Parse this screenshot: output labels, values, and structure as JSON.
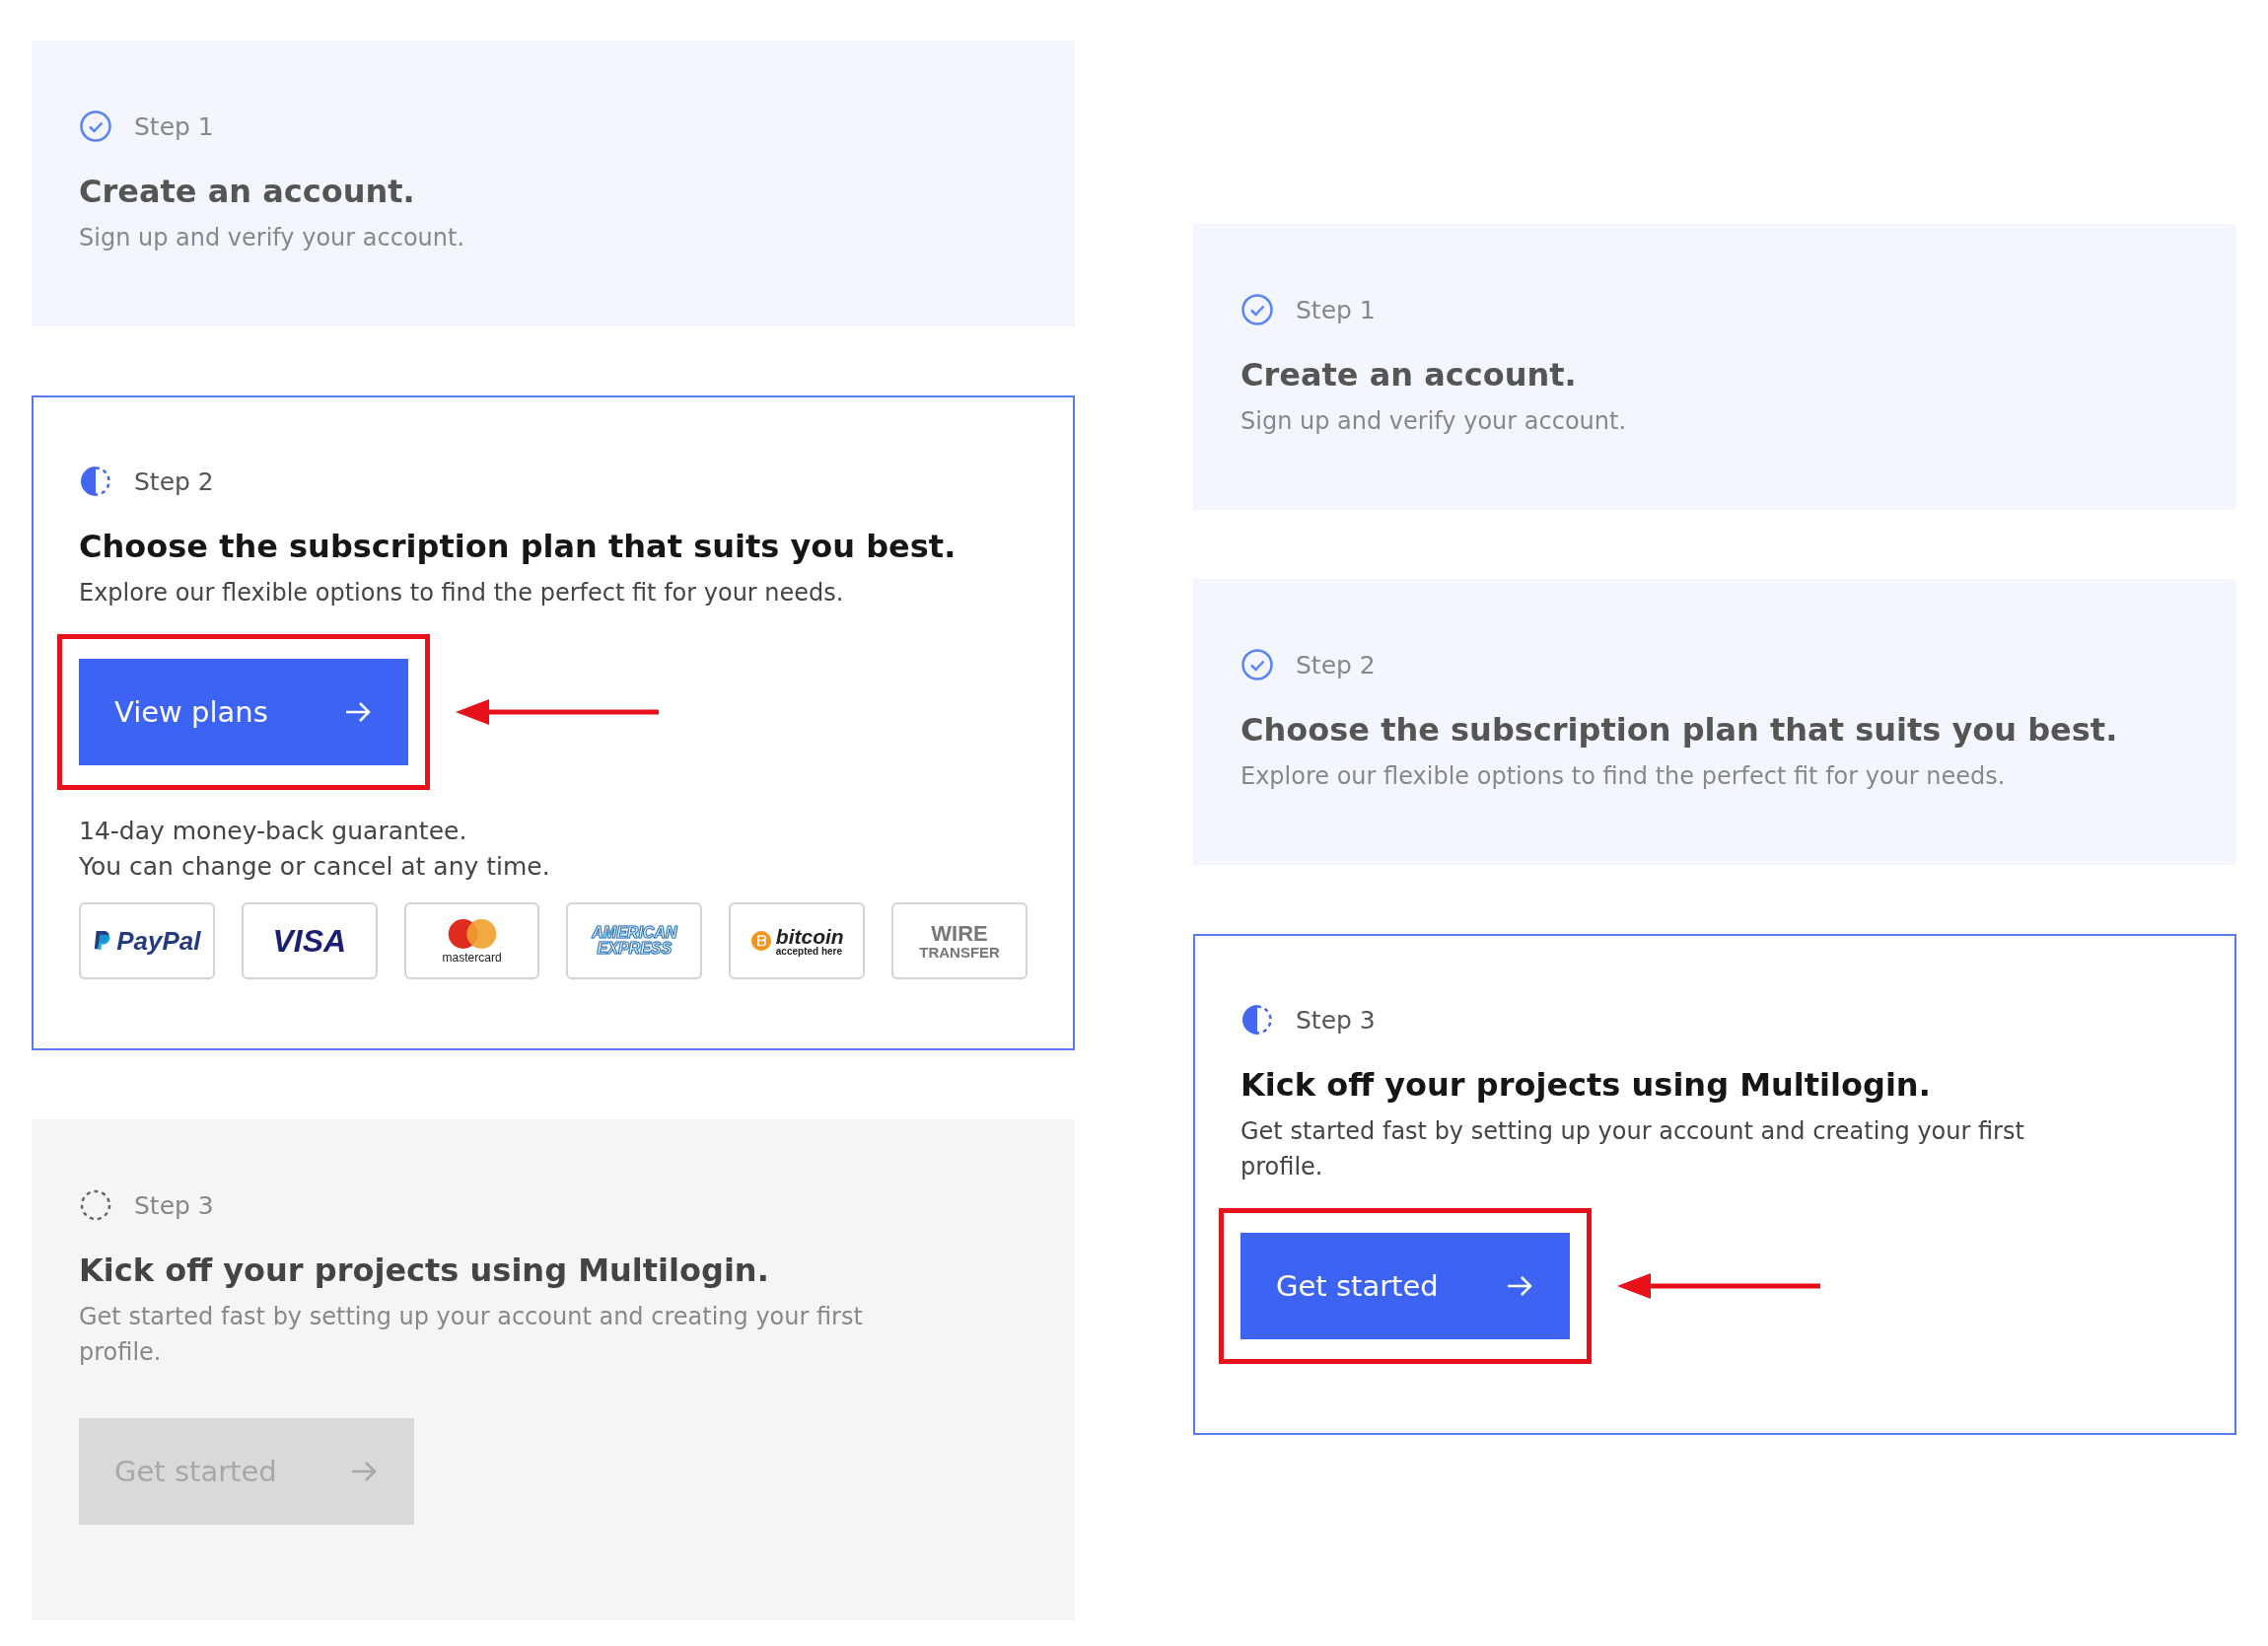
{
  "columns": [
    {
      "steps": [
        {
          "kind": "done",
          "step_label": "Step 1",
          "title": "Create an account.",
          "description": "Sign up and verify your account."
        },
        {
          "kind": "current",
          "step_label": "Step 2",
          "title": "Choose the subscription plan that suits you best.",
          "description": "Explore our flexible options to find the perfect fit for your needs.",
          "button": {
            "label": "View plans",
            "disabled": false,
            "highlighted": true
          },
          "notes": [
            "14-day money-back guarantee.",
            "You can change or cancel at any time."
          ],
          "payment_methods": [
            {
              "kind": "paypal",
              "lines": [
                "PayPal"
              ]
            },
            {
              "kind": "visa",
              "lines": [
                "VISA"
              ]
            },
            {
              "kind": "mastercard",
              "lines": [
                "mastercard"
              ]
            },
            {
              "kind": "amex",
              "lines": [
                "AMERICAN",
                "EXPRESS"
              ]
            },
            {
              "kind": "bitcoin",
              "lines": [
                "bitcoin",
                "accepted here"
              ]
            },
            {
              "kind": "wire",
              "lines": [
                "WIRE",
                "TRANSFER"
              ]
            }
          ]
        },
        {
          "kind": "pending",
          "step_label": "Step 3",
          "title": "Kick off your projects using Multilogin.",
          "description": "Get started fast by setting up your account and creating your first profile.",
          "button": {
            "label": "Get started",
            "disabled": true,
            "highlighted": false
          }
        }
      ]
    },
    {
      "steps": [
        {
          "kind": "done",
          "step_label": "Step 1",
          "title": "Create an account.",
          "description": "Sign up and verify your account."
        },
        {
          "kind": "done",
          "step_label": "Step 2",
          "title": "Choose the subscription plan that suits you best.",
          "description": "Explore our flexible options to find the perfect fit for your needs."
        },
        {
          "kind": "current",
          "step_label": "Step 3",
          "title": "Kick off your projects using Multilogin.",
          "description": "Get started fast by setting up your account and creating your first profile.",
          "button": {
            "label": "Get started",
            "disabled": false,
            "highlighted": true
          }
        }
      ]
    }
  ]
}
